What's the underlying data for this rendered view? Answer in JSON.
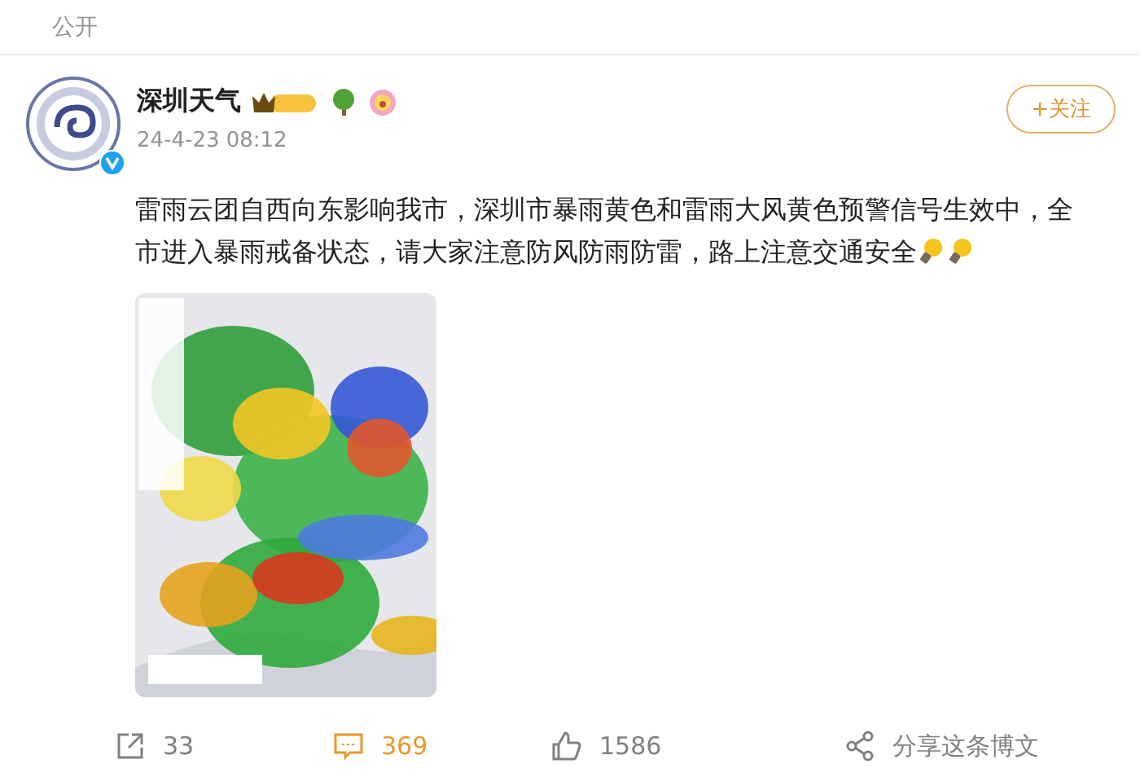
{
  "visibility": "公开",
  "post": {
    "author": "深圳天气",
    "time": "24-4-23 08:12",
    "verified": true,
    "follow_label": "+关注",
    "text_lines": [
      "雷雨云团自西向东影响我市，深圳市暴雨黄色和雷雨大风黄色预警信号生效中，全",
      "市进入暴雨戒备状态，请大家注意防风防雨防雷，路上注意交通安全"
    ]
  },
  "actions": [
    {
      "kind": "repost",
      "label": "33",
      "selected": false
    },
    {
      "kind": "comment",
      "label": "369",
      "selected": true
    },
    {
      "kind": "like",
      "label": "1586",
      "selected": false
    },
    {
      "kind": "share",
      "label": "分享这条博文",
      "selected": false
    }
  ]
}
